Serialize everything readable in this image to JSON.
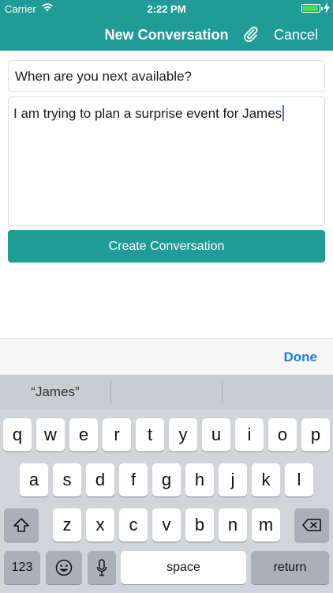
{
  "status_bar": {
    "carrier": "Carrier",
    "time": "2:22 PM",
    "battery_level": 0.95
  },
  "nav": {
    "title": "New Conversation",
    "cancel_label": "Cancel",
    "attach_icon": "paperclip-icon"
  },
  "form": {
    "subject_value": "When are you next available?",
    "message_value": "I am trying to plan a surprise event for James",
    "create_label": "Create Conversation"
  },
  "accessory": {
    "done_label": "Done"
  },
  "keyboard": {
    "suggestions": [
      "“James”",
      "",
      ""
    ],
    "row1": [
      "q",
      "w",
      "e",
      "r",
      "t",
      "y",
      "u",
      "i",
      "o",
      "p"
    ],
    "row2": [
      "a",
      "s",
      "d",
      "f",
      "g",
      "h",
      "j",
      "k",
      "l"
    ],
    "row3": [
      "z",
      "x",
      "c",
      "v",
      "b",
      "n",
      "m"
    ],
    "numbers_label": "123",
    "space_label": "space",
    "return_label": "return"
  },
  "colors": {
    "brand": "#1e9c95",
    "accent": "#1f7ae0",
    "battery": "#4cd964"
  }
}
